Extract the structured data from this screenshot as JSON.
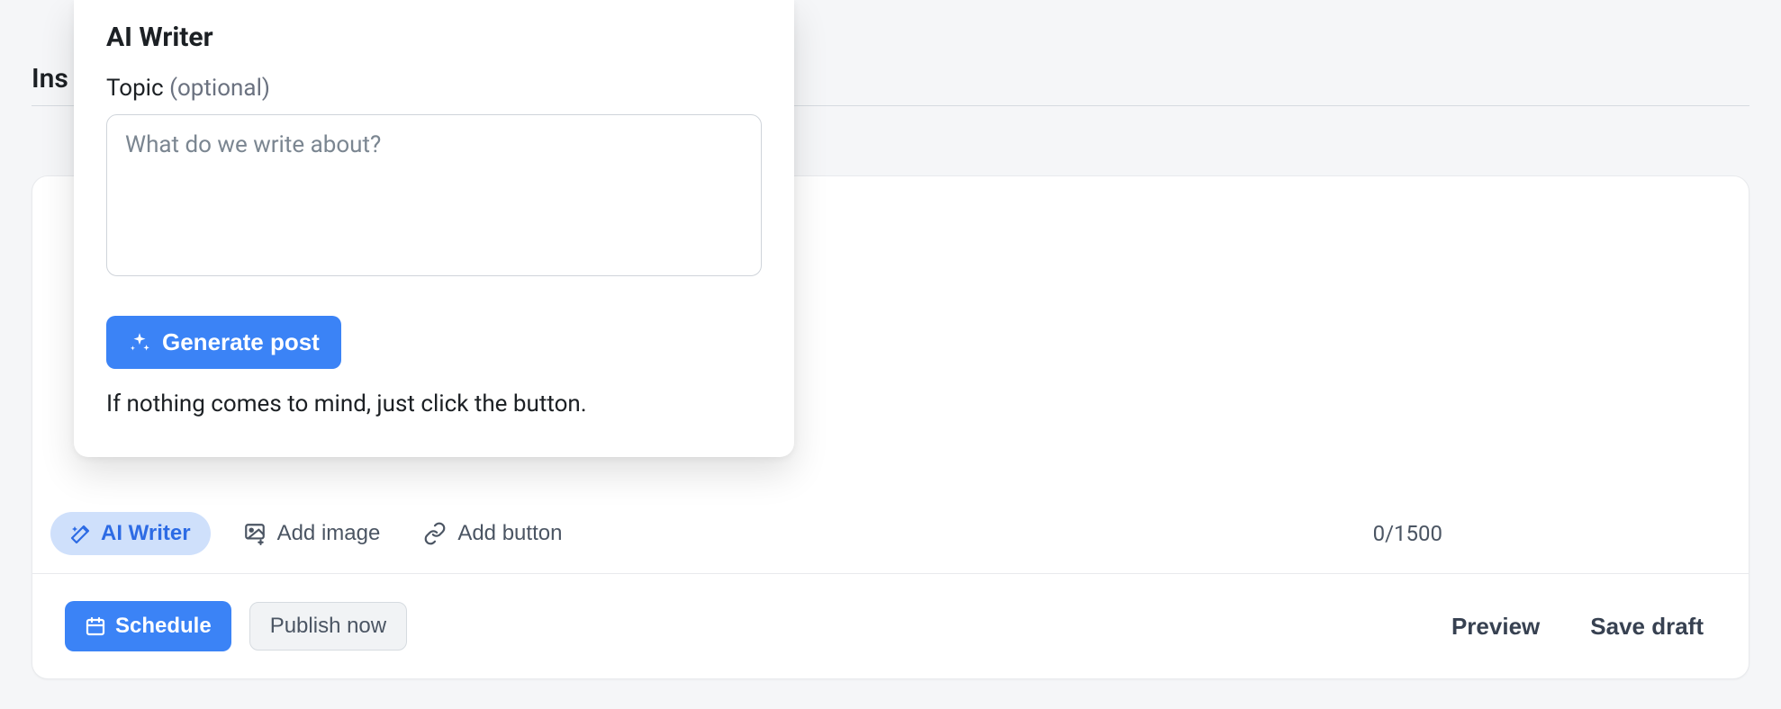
{
  "tabs": {
    "active_partial": "Ins"
  },
  "popover": {
    "title": "AI Writer",
    "topic_label": "Topic",
    "topic_optional": "(optional)",
    "topic_placeholder": "What do we write about?",
    "topic_value": "",
    "generate_label": "Generate post",
    "hint": "If nothing comes to mind, just click the button."
  },
  "toolbar": {
    "ai_writer_label": "AI Writer",
    "add_image_label": "Add image",
    "add_button_label": "Add button",
    "char_count": "0/1500"
  },
  "footer": {
    "schedule_label": "Schedule",
    "publish_label": "Publish now",
    "preview_label": "Preview",
    "save_draft_label": "Save draft"
  }
}
